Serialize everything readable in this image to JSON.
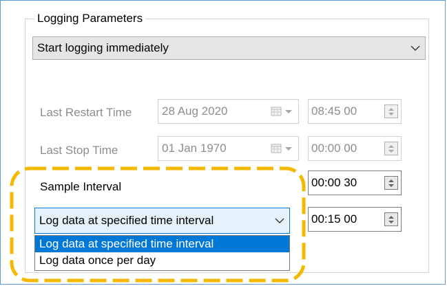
{
  "colors": {
    "highlight_border": "#f5b800",
    "selection": "#0078d7",
    "frame": "#5b9bd5"
  },
  "logging_group": {
    "title": "Logging Parameters",
    "mode_combo": {
      "value": "Start logging immediately",
      "icon": "chevron-down-icon"
    }
  },
  "last_restart": {
    "label": "Last Restart Time",
    "date": "28 Aug 2020",
    "time": "08:45 00",
    "icon": "calendar-icon"
  },
  "last_stop": {
    "label": "Last Stop Time",
    "date": "01 Jan  1970",
    "time": "00:00 00",
    "icon": "calendar-icon"
  },
  "sample_interval": {
    "label": "Sample Interval",
    "time": "00:00 30",
    "combo": {
      "value": "Log data at specified time interval",
      "icon": "chevron-down-icon"
    },
    "combo_time": "00:15 00",
    "options": [
      "Log data at specified time interval",
      "Log data once per day"
    ]
  }
}
